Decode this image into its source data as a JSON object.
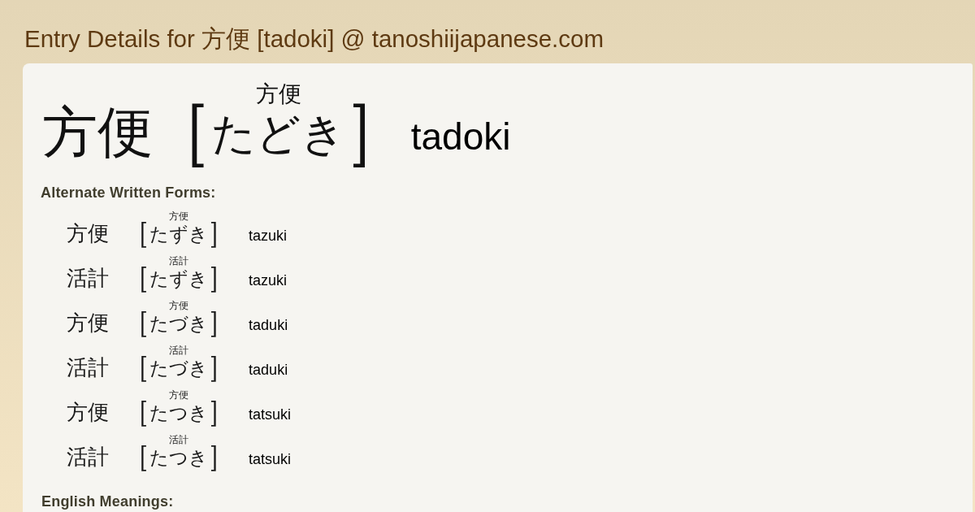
{
  "page": {
    "title": "Entry Details for 方便 [tadoki] @ tanoshiijapanese.com"
  },
  "entry": {
    "written": "方便",
    "open": "[",
    "furigana": "方便",
    "reading": "たどき",
    "close": "]",
    "romaji": "tadoki"
  },
  "alternate_forms": {
    "heading": "Alternate Written Forms:",
    "items": [
      {
        "written": "方便",
        "open": "[",
        "furigana": "方便",
        "reading": "たずき",
        "close": "]",
        "romaji": "tazuki"
      },
      {
        "written": "活計",
        "open": "[",
        "furigana": "活計",
        "reading": "たずき",
        "close": "]",
        "romaji": "tazuki"
      },
      {
        "written": "方便",
        "open": "[",
        "furigana": "方便",
        "reading": "たづき",
        "close": "]",
        "romaji": "taduki"
      },
      {
        "written": "活計",
        "open": "[",
        "furigana": "活計",
        "reading": "たづき",
        "close": "]",
        "romaji": "taduki"
      },
      {
        "written": "方便",
        "open": "[",
        "furigana": "方便",
        "reading": "たつき",
        "close": "]",
        "romaji": "tatsuki"
      },
      {
        "written": "活計",
        "open": "[",
        "furigana": "活計",
        "reading": "たつき",
        "close": "]",
        "romaji": "tatsuki"
      }
    ]
  },
  "english_meanings": {
    "heading": "English Meanings:"
  }
}
